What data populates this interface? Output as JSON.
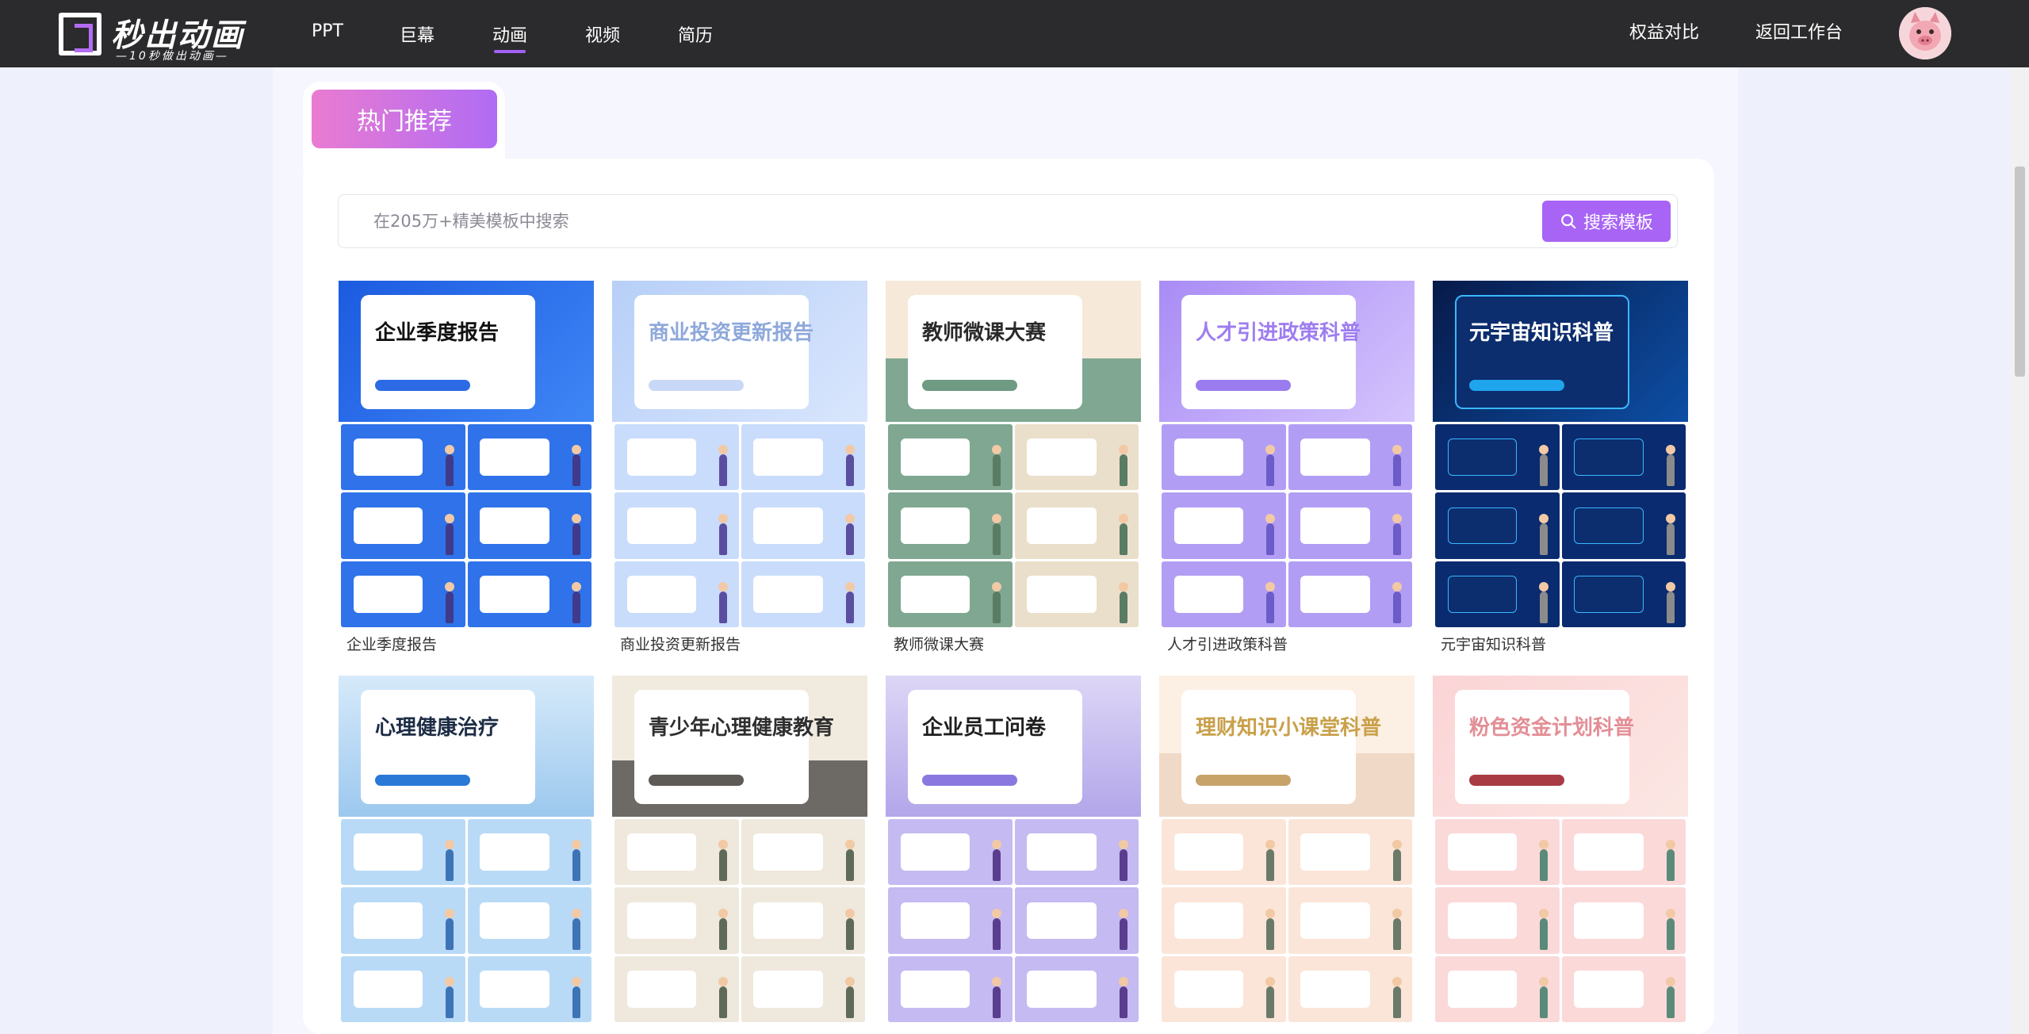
{
  "header": {
    "logo_title": "秒出动画",
    "logo_subtitle": "—10秒做出动画—",
    "nav": [
      {
        "label": "PPT"
      },
      {
        "label": "巨幕"
      },
      {
        "label": "动画",
        "active": true
      },
      {
        "label": "视频"
      },
      {
        "label": "简历"
      }
    ],
    "links": {
      "benefits": "权益对比",
      "back": "返回工作台"
    },
    "avatar_icon": "pig-avatar-icon"
  },
  "section": {
    "tab_label": "热门推荐"
  },
  "search": {
    "placeholder": "在205万+精美模板中搜索",
    "button_label": "搜索模板",
    "icon": "search-icon"
  },
  "colors": {
    "topbar": "#2b2b2d",
    "accent": "#a864f5",
    "tab_gradient_start": "#ea7bd1",
    "tab_gradient_end": "#b06cf4"
  },
  "templates": [
    {
      "label": "企业季度报告",
      "cover_text": "企业季度报告",
      "theme": "blue"
    },
    {
      "label": "商业投资更新报告",
      "cover_text": "商业投资更新报告",
      "theme": "ice"
    },
    {
      "label": "教师微课大赛",
      "cover_text": "教师微课大赛",
      "theme": "green"
    },
    {
      "label": "人才引进政策科普",
      "cover_text": "人才引进政策科普",
      "theme": "purple"
    },
    {
      "label": "元宇宙知识科普",
      "cover_text": "元宇宙知识科普",
      "theme": "navy"
    },
    {
      "label": "",
      "cover_text": "心理健康治疗",
      "theme": "sky"
    },
    {
      "label": "",
      "cover_text": "青少年心理健康教育",
      "theme": "class"
    },
    {
      "label": "",
      "cover_text": "企业员工问卷",
      "theme": "lilac"
    },
    {
      "label": "",
      "cover_text": "理财知识小课堂科普",
      "theme": "peach"
    },
    {
      "label": "",
      "cover_text": "粉色资金计划科普",
      "theme": "pink"
    }
  ]
}
